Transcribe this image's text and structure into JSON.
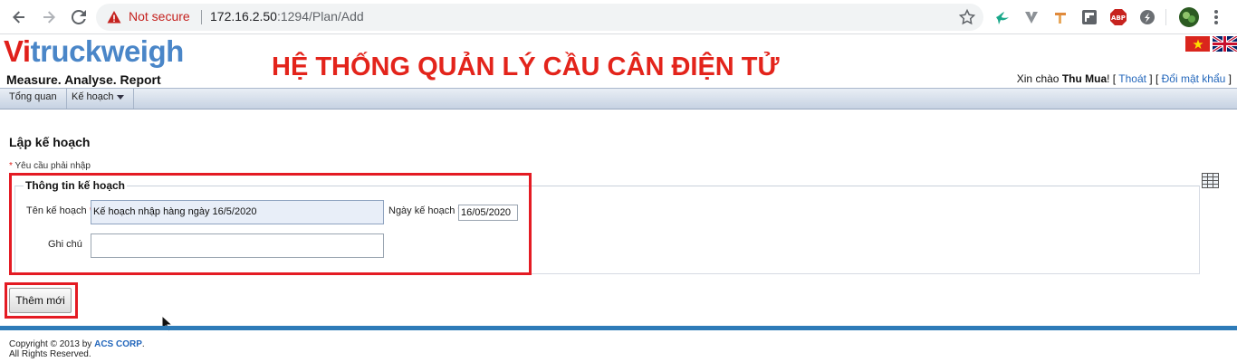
{
  "browser": {
    "security_label": "Not secure",
    "url_host": "172.16.2.50",
    "url_path": ":1294/Plan/Add",
    "nav_icons": [
      "back-icon",
      "forward-icon",
      "reload-icon"
    ],
    "extension_icons": [
      "hummingbird-icon",
      "vee-icon",
      "pin-icon",
      "flipboard-icon",
      "adblock-plus-icon",
      "sync-icon",
      "profile-avatar-icon",
      "menu-kebab-icon"
    ],
    "adblock_text": "ABP"
  },
  "header": {
    "logo_prefix": "Vi",
    "logo_rest": "truckweigh",
    "tagline": "Measure. Analyse. Report",
    "system_title": "HỆ THỐNG QUẢN LÝ CẦU CÂN ĐIỆN TỬ",
    "greeting_prefix": "Xin chào ",
    "user_name": "Thu Mua",
    "greeting_exclaim": "! [ ",
    "logout_label": "Thoát",
    "sep": " ] [ ",
    "change_password_label": "Đổi mật khẩu",
    "end_bracket": " ]"
  },
  "menu": {
    "items": [
      {
        "label": "Tổng quan"
      },
      {
        "label": "Kế hoạch"
      }
    ]
  },
  "form": {
    "page_title": "Lập kế hoạch",
    "required_note": "Yêu cầu phải nhập",
    "required_star": "*",
    "section_legend": "Thông tin kế hoạch",
    "plan_name_label": "Tên kế hoạch",
    "plan_name_value": "Kế hoạch nhập hàng ngày 16/5/2020",
    "plan_date_label": "Ngày kế hoạch",
    "plan_date_value": "16/05/2020",
    "note_label": "Ghi chú",
    "note_value": "",
    "submit_label": "Thêm mới"
  },
  "footer": {
    "copyright_prefix": "Copyright © 2013 by ",
    "company": "ACS CORP",
    "copyright_suffix": ".",
    "rights": "All Rights Reserved."
  },
  "colors": {
    "brand_red": "#e0201b",
    "brand_blue": "#4a86c8",
    "highlight_red": "#e41b23",
    "divider_blue": "#2e7bb8"
  }
}
